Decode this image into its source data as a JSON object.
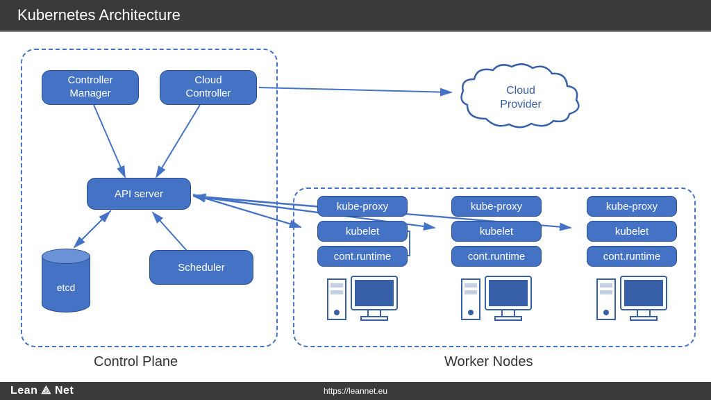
{
  "title": "Kubernetes Architecture",
  "control_plane": {
    "label": "Control Plane",
    "controller_manager": "Controller Manager",
    "cloud_controller": "Cloud Controller",
    "api_server": "API server",
    "scheduler": "Scheduler",
    "etcd": "etcd"
  },
  "worker": {
    "label": "Worker Nodes",
    "kube_proxy": "kube-proxy",
    "kubelet": "kubelet",
    "runtime": "cont.runtime"
  },
  "cloud_provider": "Cloud Provider",
  "footer": {
    "brand": "Lean ⟁ Net",
    "url": "https://leannet.eu"
  }
}
